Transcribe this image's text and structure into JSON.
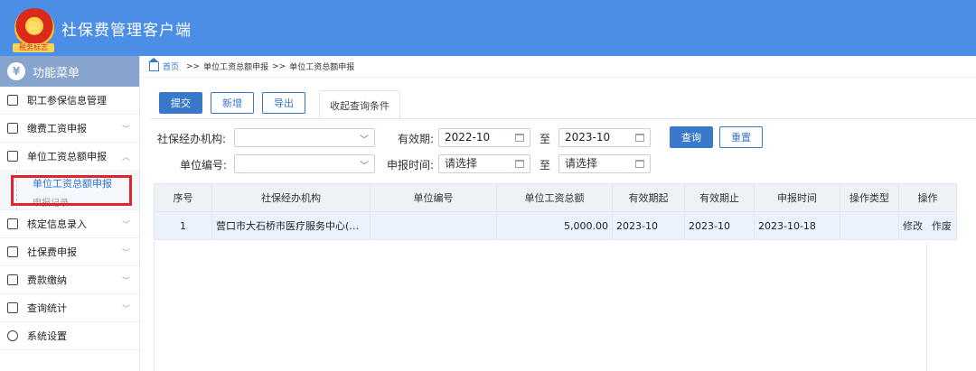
{
  "header": {
    "app_title": "社保费管理客户端",
    "emblem_text": "税",
    "emblem_sub": "税务标志"
  },
  "sidebar": {
    "menu_title": "功能菜单",
    "items": [
      {
        "label": "职工参保信息管理",
        "icon": "grid-icon"
      },
      {
        "label": "缴费工资申报",
        "icon": "edit-icon"
      },
      {
        "label": "单位工资总额申报",
        "icon": "calendar-icon"
      },
      {
        "label": "核定信息录入",
        "icon": "calendar-icon"
      },
      {
        "label": "社保费申报",
        "icon": "calendar-icon"
      },
      {
        "label": "费款缴纳",
        "icon": "book-icon"
      },
      {
        "label": "查询统计",
        "icon": "chart-icon"
      },
      {
        "label": "系统设置",
        "icon": "gear-icon"
      }
    ],
    "sub_active": "单位工资总额申报",
    "sub_record": "申报记录"
  },
  "breadcrumb": {
    "home": "首页",
    "sep": ">>",
    "level1": "单位工资总额申报",
    "level2": "单位工资总额申报"
  },
  "toolbar": {
    "submit": "提交",
    "add": "新增",
    "export": "导出",
    "collapse_tab": "收起查询条件"
  },
  "filters": {
    "agency_label": "社保经办机构:",
    "agency_value": "",
    "valid_label": "有效期:",
    "valid_from": "2022-10",
    "to_label": "至",
    "valid_to": "2023-10",
    "unit_label": "单位编号:",
    "unit_value": "",
    "report_label": "申报时间:",
    "report_from": "请选择",
    "report_to": "请选择",
    "query_btn": "查询",
    "reset_btn": "重置"
  },
  "table": {
    "headers": [
      "序号",
      "社保经办机构",
      "单位编号",
      "单位工资总额",
      "有效期起",
      "有效期止",
      "申报时间",
      "操作类型",
      "操作"
    ],
    "rows": [
      {
        "no": "1",
        "agency": "营口市大石桥市医疗服务中心(医疗...",
        "unit": "",
        "amount": "5,000.00",
        "start": "2023-10",
        "end": "2023-10",
        "report_time": "2023-10-18",
        "op_type": "",
        "op_edit": "修改",
        "op_void": "作废"
      }
    ]
  },
  "colors": {
    "header_bg": "#4b8ee6",
    "menu_head_bg": "#87a4cf",
    "primary": "#3a78c9",
    "highlight": "#e0242c"
  }
}
